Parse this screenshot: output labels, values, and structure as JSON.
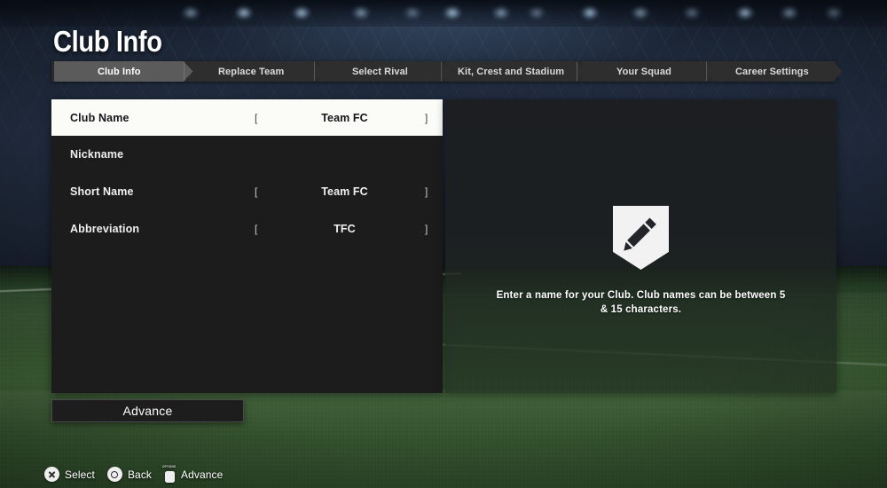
{
  "header": {
    "title": "Club Info"
  },
  "breadcrumb": {
    "tabs": [
      {
        "label": "Club Info",
        "active": true
      },
      {
        "label": "Replace Team",
        "active": false
      },
      {
        "label": "Select Rival",
        "active": false
      },
      {
        "label": "Kit, Crest and Stadium",
        "active": false
      },
      {
        "label": "Your Squad",
        "active": false
      },
      {
        "label": "Career Settings",
        "active": false
      }
    ]
  },
  "form": {
    "bracket_left": "[",
    "bracket_right": "]",
    "rows": [
      {
        "label": "Club Name",
        "value": "Team FC",
        "selected": true,
        "has_value": true
      },
      {
        "label": "Nickname",
        "value": "",
        "selected": false,
        "has_value": false
      },
      {
        "label": "Short Name",
        "value": "Team FC",
        "selected": false,
        "has_value": true
      },
      {
        "label": "Abbreviation",
        "value": "TFC",
        "selected": false,
        "has_value": true
      }
    ]
  },
  "info_panel": {
    "icon": "shield-pencil-icon",
    "description": "Enter a name for your Club. Club names can be between 5 & 15 characters."
  },
  "actions": {
    "advance_label": "Advance"
  },
  "footer": {
    "prompts": [
      {
        "icon": "playstation-cross-icon",
        "label": "Select"
      },
      {
        "icon": "playstation-circle-icon",
        "label": "Back"
      },
      {
        "icon": "playstation-options-icon",
        "label": "Advance",
        "cap_text": "OPTIONS"
      }
    ]
  },
  "colors": {
    "panel_dark": "#1c1c1c",
    "row_selected_bg": "#fbfbf8",
    "crumb_active_bg": "#5b5b5b",
    "crumb_bg": "#2e2e2e",
    "accent_text": "#ffffff",
    "pitch_green": "#3b5e33",
    "sky_navy": "#222d40"
  }
}
